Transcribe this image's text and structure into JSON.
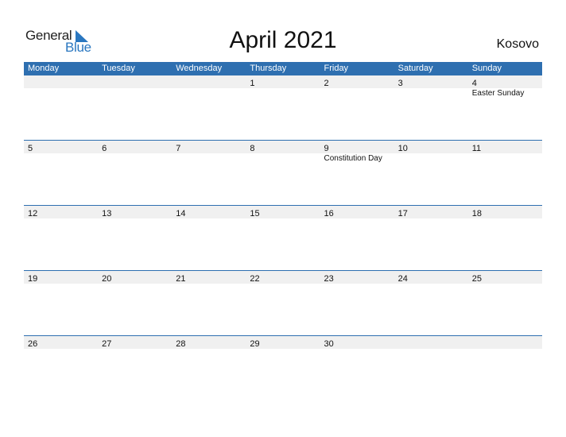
{
  "logo": {
    "word1": "General",
    "word2": "Blue"
  },
  "title": "April 2021",
  "country": "Kosovo",
  "colors": {
    "header": "#2e6fb0",
    "strip": "#f0f0f0",
    "brand": "#2a77c0"
  },
  "weekdays": [
    "Monday",
    "Tuesday",
    "Wednesday",
    "Thursday",
    "Friday",
    "Saturday",
    "Sunday"
  ],
  "weeks": [
    [
      {
        "d": ""
      },
      {
        "d": ""
      },
      {
        "d": ""
      },
      {
        "d": "1"
      },
      {
        "d": "2"
      },
      {
        "d": "3"
      },
      {
        "d": "4",
        "h": "Easter Sunday"
      }
    ],
    [
      {
        "d": "5"
      },
      {
        "d": "6"
      },
      {
        "d": "7"
      },
      {
        "d": "8"
      },
      {
        "d": "9",
        "h": "Constitution Day"
      },
      {
        "d": "10"
      },
      {
        "d": "11"
      }
    ],
    [
      {
        "d": "12"
      },
      {
        "d": "13"
      },
      {
        "d": "14"
      },
      {
        "d": "15"
      },
      {
        "d": "16"
      },
      {
        "d": "17"
      },
      {
        "d": "18"
      }
    ],
    [
      {
        "d": "19"
      },
      {
        "d": "20"
      },
      {
        "d": "21"
      },
      {
        "d": "22"
      },
      {
        "d": "23"
      },
      {
        "d": "24"
      },
      {
        "d": "25"
      }
    ],
    [
      {
        "d": "26"
      },
      {
        "d": "27"
      },
      {
        "d": "28"
      },
      {
        "d": "29"
      },
      {
        "d": "30"
      },
      {
        "d": ""
      },
      {
        "d": ""
      }
    ]
  ]
}
